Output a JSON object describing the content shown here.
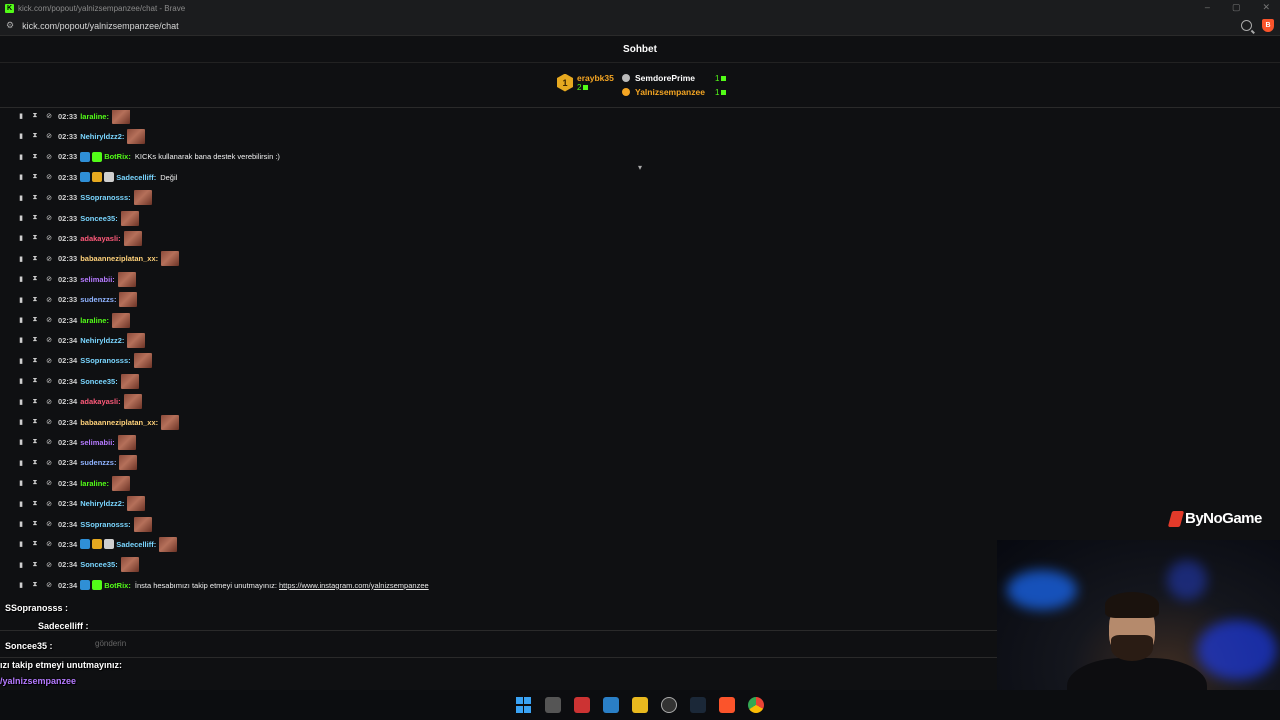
{
  "browser": {
    "title": "kick.com/popout/yalnizsempanzee/chat - Brave",
    "url": "kick.com/popout/yalnizsempanzee/chat"
  },
  "chat": {
    "header": "Sohbet",
    "leaderboard": {
      "first": {
        "rank": "1",
        "name": "eraybk35",
        "count": "2"
      },
      "others": [
        {
          "name": "SemdorePrime",
          "count": "1",
          "color": "#ffffff"
        },
        {
          "name": "Yalnizsempanzee",
          "count": "1",
          "color": "#f5a623"
        }
      ]
    },
    "messages": [
      {
        "time": "02:33",
        "user": "laraline",
        "color": "#53fc18",
        "badges": [],
        "text": "",
        "emote": true
      },
      {
        "time": "02:33",
        "user": "Nehiryldzz2",
        "color": "#7ad6ff",
        "badges": [],
        "text": "",
        "emote": true
      },
      {
        "time": "02:33",
        "user": "BotRix",
        "color": "#53fc18",
        "badges": [
          "#2f8fd6",
          "#53fc18"
        ],
        "text": "KICKs kullanarak bana destek verebilirsin :)",
        "emote": false
      },
      {
        "time": "02:33",
        "user": "Sadecelliff",
        "color": "#7ad6ff",
        "badges": [
          "#2f8fd6",
          "#e6a920",
          "#cfcfcf"
        ],
        "text": "Değil",
        "emote": false
      },
      {
        "time": "02:33",
        "user": "SSopranosss",
        "color": "#7ad6ff",
        "badges": [],
        "text": "",
        "emote": true
      },
      {
        "time": "02:33",
        "user": "Soncee35",
        "color": "#7ad6ff",
        "badges": [],
        "text": "",
        "emote": true
      },
      {
        "time": "02:33",
        "user": "adakayasli",
        "color": "#ff5a7a",
        "badges": [],
        "text": "",
        "emote": true
      },
      {
        "time": "02:33",
        "user": "babaanneziplatan_xx",
        "color": "#ffd27a",
        "badges": [],
        "text": "",
        "emote": true
      },
      {
        "time": "02:33",
        "user": "selimabii",
        "color": "#b57aff",
        "badges": [],
        "text": "",
        "emote": true
      },
      {
        "time": "02:33",
        "user": "sudenzzs",
        "color": "#8fb3ff",
        "badges": [],
        "text": "",
        "emote": true
      },
      {
        "time": "02:34",
        "user": "laraline",
        "color": "#53fc18",
        "badges": [],
        "text": "",
        "emote": true
      },
      {
        "time": "02:34",
        "user": "Nehiryldzz2",
        "color": "#7ad6ff",
        "badges": [],
        "text": "",
        "emote": true
      },
      {
        "time": "02:34",
        "user": "SSopranosss",
        "color": "#7ad6ff",
        "badges": [],
        "text": "",
        "emote": true
      },
      {
        "time": "02:34",
        "user": "Soncee35",
        "color": "#7ad6ff",
        "badges": [],
        "text": "",
        "emote": true
      },
      {
        "time": "02:34",
        "user": "adakayasli",
        "color": "#ff5a7a",
        "badges": [],
        "text": "",
        "emote": true
      },
      {
        "time": "02:34",
        "user": "babaanneziplatan_xx",
        "color": "#ffd27a",
        "badges": [],
        "text": "",
        "emote": true
      },
      {
        "time": "02:34",
        "user": "selimabii",
        "color": "#b57aff",
        "badges": [],
        "text": "",
        "emote": true
      },
      {
        "time": "02:34",
        "user": "sudenzzs",
        "color": "#8fb3ff",
        "badges": [],
        "text": "",
        "emote": true
      },
      {
        "time": "02:34",
        "user": "laraline",
        "color": "#53fc18",
        "badges": [],
        "text": "",
        "emote": true
      },
      {
        "time": "02:34",
        "user": "Nehiryldzz2",
        "color": "#7ad6ff",
        "badges": [],
        "text": "",
        "emote": true
      },
      {
        "time": "02:34",
        "user": "SSopranosss",
        "color": "#7ad6ff",
        "badges": [],
        "text": "",
        "emote": true
      },
      {
        "time": "02:34",
        "user": "Sadecelliff",
        "color": "#7ad6ff",
        "badges": [
          "#2f8fd6",
          "#e6a920",
          "#cfcfcf"
        ],
        "text": "",
        "emote": true
      },
      {
        "time": "02:34",
        "user": "Soncee35",
        "color": "#7ad6ff",
        "badges": [],
        "text": "",
        "emote": true
      },
      {
        "time": "02:34",
        "user": "BotRix",
        "color": "#53fc18",
        "badges": [
          "#2f8fd6",
          "#53fc18"
        ],
        "text": "İnsta hesabımızı takip etmeyi unutmayınız:",
        "link": "https://www.instagram.com/yalnizsempanzee",
        "emote": false
      }
    ],
    "composer_placeholder": "gönderin"
  },
  "overlay": {
    "line1": "SSopranosss :",
    "line2": "Sadecelliff :",
    "line3": "Soncee35 :",
    "line4": "ızı takip etmeyi unutmayınız:",
    "line5": "/yalnizsempanzee"
  },
  "watermark": "ByNoGame"
}
